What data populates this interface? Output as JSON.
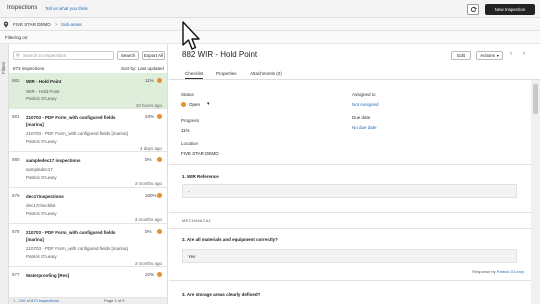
{
  "topbar": {
    "title": "Inspections",
    "feedback": "Tell us what you think",
    "new_button": "New Inspection"
  },
  "breadcrumb": {
    "root": "FIVE STAR DEMO",
    "separator": ">",
    "current": "Sub-areas"
  },
  "filter": {
    "label": "Filtering on:",
    "side_label": "Filters"
  },
  "list": {
    "search_placeholder": "Search in Inspections",
    "search_button": "Search",
    "export_button": "Export All",
    "count": "873 inspections",
    "sort": "Sort by: Last updated",
    "items": [
      {
        "num": "882",
        "name": "WIR - Hold Point",
        "pct": "11%",
        "sub": "WIR - Hold Point",
        "who": "Patrick O'Leary",
        "when": "10 hours ago"
      },
      {
        "num": "881",
        "name": "210703 - PDF Form_with configured fields [marina]",
        "pct": "23%",
        "sub": "210703 - PDF Form_with configured fields [marina]",
        "who": "Patrick O'Leary",
        "when": "4 days ago"
      },
      {
        "num": "880",
        "name": "sampledec17 inspections",
        "pct": "0%",
        "sub": "sampledec17",
        "who": "Patrick O'Leary",
        "when": "3 months ago"
      },
      {
        "num": "879",
        "name": "dec17inspections",
        "pct": "100%",
        "sub": "dec17checklist",
        "who": "Patrick O'Leary",
        "when": "3 months ago"
      },
      {
        "num": "878",
        "name": "210703 - PDF Form_with configured fields [marina]",
        "pct": "0%",
        "sub": "210703 - PDF Form_with configured fields [marina]",
        "who": "Patrick O'Leary",
        "when": "3 months ago"
      },
      {
        "num": "877",
        "name": "Waterproofing [Res]",
        "pct": "22%",
        "sub": "",
        "who": "",
        "when": ""
      }
    ],
    "pager_info": "1 - 100 of 873 inspections",
    "pager_pages": "Page 1 of 9"
  },
  "detail": {
    "title": "882  WIR - Hold Point",
    "edit_button": "Edit",
    "actions_button": "Actions",
    "tabs": [
      "Checklist",
      "Properties",
      "Attachments (0)"
    ],
    "status_label": "Status",
    "status_value": "Open",
    "assigned_label": "Assigned to",
    "assigned_value": "Not Assigned",
    "progress_label": "Progress",
    "progress_value": "11%",
    "due_label": "Due date",
    "due_value": "No due date",
    "location_label": "Location",
    "location_value": "FIVE STAR DEMO",
    "q1": "1.   WIR Reference",
    "q1_answer": "-",
    "section": "MECHANICAL",
    "q2": "2.   Are all materials and equipment correctly?",
    "q2_answer": "Yes",
    "respond_prefix": "Response by",
    "respond_name": "Patrick O'Leary",
    "q3": "3.   Are storage areas clearly defined?"
  },
  "colors": {
    "accent": "#2b6cb0",
    "status_dot": "#e8902f",
    "selected_row": "#dfeeda"
  }
}
